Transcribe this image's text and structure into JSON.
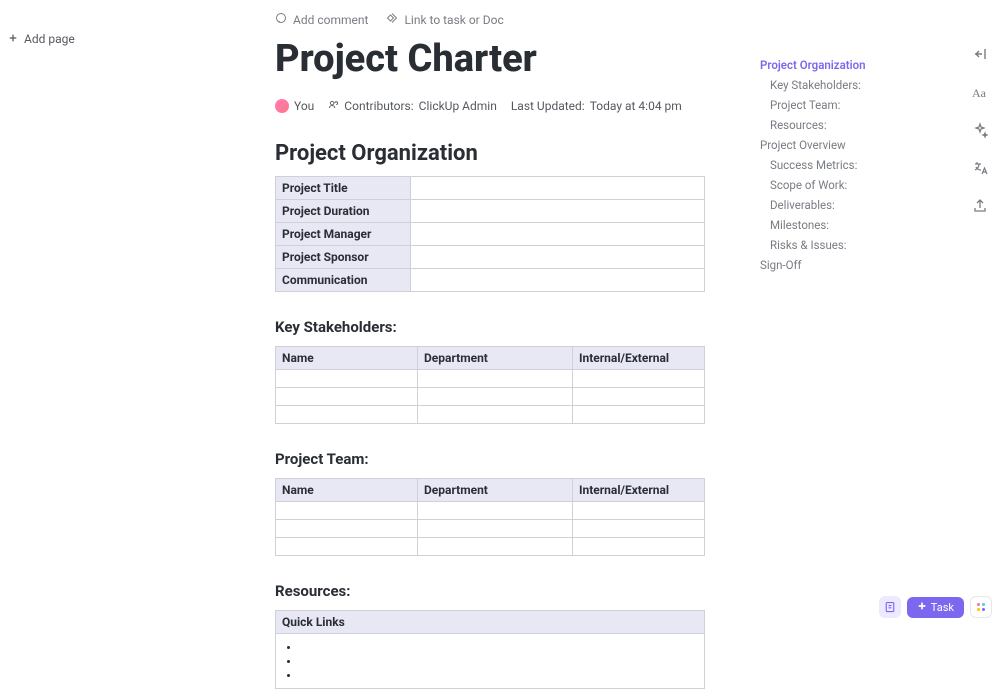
{
  "sidebar": {
    "add_page": "Add page"
  },
  "top_actions": {
    "add_comment": "Add comment",
    "link_to": "Link to task or Doc"
  },
  "page": {
    "title": "Project Charter"
  },
  "meta": {
    "you": "You",
    "contributors_label": "Contributors:",
    "contributors_value": "ClickUp Admin",
    "updated_label": "Last Updated:",
    "updated_value": "Today at 4:04 pm"
  },
  "sections": {
    "org_heading": "Project Organization",
    "stakeholders_heading": "Key Stakeholders:",
    "team_heading": "Project Team:",
    "resources_heading": "Resources:"
  },
  "org_table": {
    "rows": [
      "Project Title",
      "Project Duration",
      "Project Manager",
      "Project Sponsor",
      "Communication"
    ]
  },
  "stakeholders_table": {
    "headers": [
      "Name",
      "Department",
      "Internal/External"
    ]
  },
  "team_table": {
    "headers": [
      "Name",
      "Department",
      "Internal/External"
    ]
  },
  "resources_table": {
    "header": "Quick Links"
  },
  "outline": {
    "items": [
      {
        "label": "Project Organization",
        "indent": false,
        "active": true
      },
      {
        "label": "Key Stakeholders:",
        "indent": true,
        "active": false
      },
      {
        "label": "Project Team:",
        "indent": true,
        "active": false
      },
      {
        "label": "Resources:",
        "indent": true,
        "active": false
      },
      {
        "label": "Project Overview",
        "indent": false,
        "active": false
      },
      {
        "label": "Success Metrics:",
        "indent": true,
        "active": false
      },
      {
        "label": "Scope of Work:",
        "indent": true,
        "active": false
      },
      {
        "label": "Deliverables:",
        "indent": true,
        "active": false
      },
      {
        "label": "Milestones:",
        "indent": true,
        "active": false
      },
      {
        "label": "Risks & Issues:",
        "indent": true,
        "active": false
      },
      {
        "label": "Sign-Off",
        "indent": false,
        "active": false
      }
    ]
  },
  "bottom": {
    "task": "Task"
  }
}
